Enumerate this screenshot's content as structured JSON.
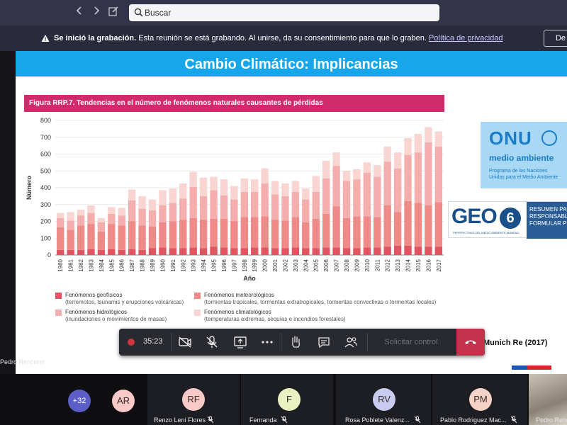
{
  "topbar": {
    "search_placeholder": "Buscar",
    "icons": [
      "chevron-left-icon",
      "chevron-right-icon",
      "compose-icon",
      "search-icon"
    ]
  },
  "banner": {
    "bold": "Se inició la grabación.",
    "text": "Esta reunión se está grabando. Al unirse, da su consentimiento para que lo graben.",
    "link": "Política de privacidad",
    "dismiss_label": "De"
  },
  "slide": {
    "title": "Cambio Climático: Implicancias",
    "figure_title": "Figura RRP.7. Tendencias en el número de fenómenos naturales causantes de pérdidas",
    "source": "Munich Re (2017)",
    "onu": {
      "big": "ONU",
      "sub": "medio ambiente",
      "small1": "Programa de las Naciones",
      "small2": "Unidas para el Medio Ambiente"
    },
    "geo": {
      "logo": "GEO",
      "six": "6",
      "panel": [
        "RESUMEN PARA",
        "RESPONSABLES",
        "FORMULAR PO"
      ],
      "tiny": "PERSPECTIVAS DEL MEDIO AMBIENTE MUNDIAL"
    }
  },
  "legend": [
    {
      "title": "Fenómenos geofísicos",
      "desc": "(terremotos, tsunamis y erupciones volcánicas)",
      "color": "#e05561"
    },
    {
      "title": "Fenómenos meteorológicos",
      "desc": "(tormentas tropicales, tormentas extratropicales, tormentas convectivas o tormentas locales)",
      "color": "#ee8a88"
    },
    {
      "title": "Fenómenos hidrológicos",
      "desc": "(inundaciones o movimientos de masas)",
      "color": "#f4aeae"
    },
    {
      "title": "Fenómenos climatológicos",
      "desc": "(temperaturas extremas, sequías e incendios forestales)",
      "color": "#f9d5d2"
    }
  ],
  "chart_data": {
    "type": "bar",
    "stacked": true,
    "xlabel": "Año",
    "ylabel": "Número",
    "ylim": [
      0,
      800
    ],
    "yticks": [
      0,
      100,
      200,
      300,
      400,
      500,
      600,
      700,
      800
    ],
    "grid": true,
    "categories": [
      "1980",
      "1981",
      "1982",
      "1983",
      "1984",
      "1985",
      "1986",
      "1987",
      "1988",
      "1989",
      "1990",
      "1991",
      "1992",
      "1993",
      "1994",
      "1995",
      "1996",
      "1997",
      "1998",
      "1999",
      "2000",
      "2001",
      "2002",
      "2003",
      "2004",
      "2005",
      "2006",
      "2007",
      "2008",
      "2009",
      "2010",
      "2011",
      "2012",
      "2013",
      "2014",
      "2015",
      "2016",
      "2017"
    ],
    "series": [
      {
        "name": "Fenómenos geofísicos",
        "color": "#e05561",
        "values": [
          30,
          30,
          30,
          35,
          30,
          35,
          30,
          35,
          30,
          40,
          45,
          40,
          40,
          45,
          40,
          50,
          45,
          40,
          40,
          45,
          45,
          40,
          40,
          45,
          40,
          40,
          45,
          45,
          40,
          40,
          45,
          45,
          50,
          55,
          55,
          50,
          50,
          50
        ]
      },
      {
        "name": "Fenómenos meteorológicos",
        "color": "#ee8a88",
        "values": [
          135,
          120,
          145,
          150,
          110,
          150,
          145,
          165,
          145,
          130,
          150,
          160,
          170,
          175,
          170,
          165,
          170,
          160,
          185,
          180,
          185,
          170,
          165,
          180,
          155,
          175,
          200,
          245,
          180,
          190,
          185,
          180,
          245,
          200,
          265,
          260,
          245,
          265
        ]
      },
      {
        "name": "Fenómenos hidrológicos",
        "color": "#f4aeae",
        "values": [
          55,
          55,
          60,
          65,
          55,
          60,
          60,
          125,
          100,
          95,
          100,
          110,
          125,
          185,
          140,
          170,
          140,
          130,
          150,
          150,
          195,
          150,
          145,
          150,
          135,
          160,
          210,
          240,
          220,
          220,
          260,
          240,
          260,
          260,
          275,
          300,
          375,
          330
        ]
      },
      {
        "name": "Fenómenos climatológicos",
        "color": "#f9d5d2",
        "values": [
          30,
          50,
          35,
          45,
          25,
          40,
          45,
          65,
          75,
          65,
          90,
          85,
          90,
          90,
          110,
          80,
          95,
          80,
          80,
          75,
          90,
          80,
          75,
          65,
          65,
          95,
          105,
          80,
          60,
          60,
          60,
          70,
          90,
          95,
          100,
          110,
          90,
          90
        ]
      }
    ]
  },
  "controls": {
    "timer": "35:23",
    "request_control": "Solicitar control",
    "icons": [
      "record-icon",
      "camera-off-icon",
      "mic-off-icon",
      "share-screen-icon",
      "more-icon",
      "raise-hand-icon",
      "chat-icon",
      "participants-icon",
      "hang-up-icon"
    ]
  },
  "presenter_label": "Pedro Rencoret",
  "gallery": {
    "overflow_count": "+32",
    "participants": [
      {
        "initials": "AR",
        "name": "",
        "color": "#f7c9c7"
      },
      {
        "initials": "RF",
        "name": "Renzo Leni Flores",
        "color": "#f7c9c7"
      },
      {
        "initials": "F",
        "name": "Fernanda",
        "color": "#e9f0c2"
      },
      {
        "initials": "RV",
        "name": "Rosa Poblete Valenz...",
        "color": "#c9cbef"
      },
      {
        "initials": "PM",
        "name": "Pablo Rodriguez Mac...",
        "color": "#f4d3c6"
      },
      {
        "initials": "",
        "name": "Pedro Renc",
        "color": ""
      }
    ]
  }
}
